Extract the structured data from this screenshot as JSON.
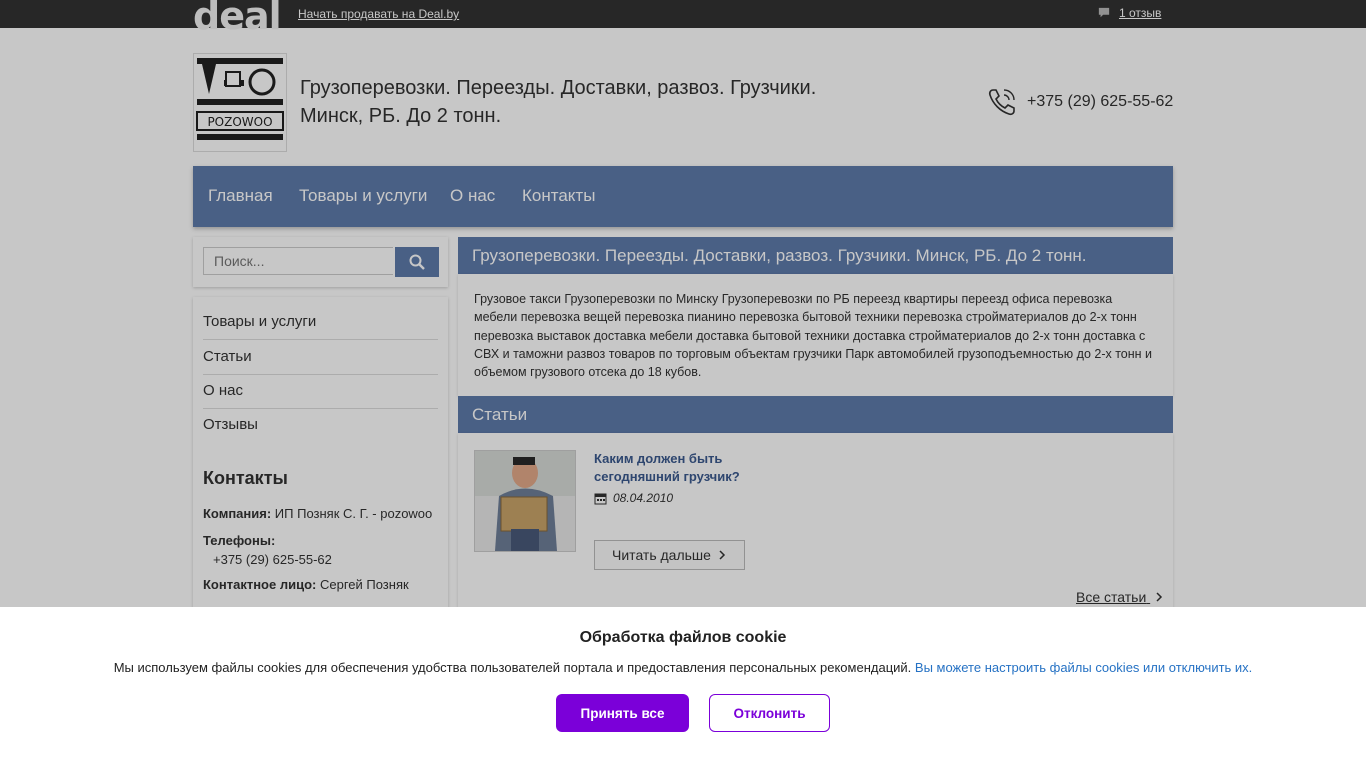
{
  "topbar": {
    "logo_text": "deal",
    "sell_link": "Начать продавать на Deal.by",
    "reviews_link": "1 отзыв"
  },
  "header": {
    "logo_text": "POZOWOO",
    "title": "Грузоперевозки. Переезды. Доставки, развоз. Грузчики. Минск, РБ. До 2 тонн.",
    "phone": "+375 (29) 625-55-62"
  },
  "nav": {
    "items": [
      "Главная",
      "Товары и услуги",
      "О нас",
      "Контакты"
    ]
  },
  "sidebar": {
    "search_placeholder": "Поиск...",
    "menu": [
      "Товары и услуги",
      "Статьи",
      "О нас",
      "Отзывы"
    ],
    "contacts_title": "Контакты",
    "company_label": "Компания:",
    "company_value": "ИП Позняк С. Г. - pozowoo",
    "phones_label": "Телефоны:",
    "phones_value": "+375 (29) 625-55-62",
    "person_label": "Контактное лицо:",
    "person_value": "Сергей Позняк"
  },
  "main": {
    "heading": "Грузоперевозки. Переезды. Доставки, развоз. Грузчики. Минск, РБ. До 2 тонн.",
    "description": "Грузовое такси Грузоперевозки по Минску Грузоперевозки по РБ переезд квартиры переезд офиса перевозка мебели перевозка вещей перевозка пианино перевозка бытовой техники перевозка стройматериалов до 2-х тонн перевозка выставок доставка мебели доставка бытовой техники доставка стройматериалов до 2-х тонн доставка с СВХ и таможни развоз товаров по торговым объектам грузчики Парк автомобилей грузоподъемностью до 2-х тонн и объемом грузового отсека до 18 кубов.",
    "articles_heading": "Статьи",
    "article_title": "Каким должен быть сегодняшний грузчик?",
    "article_date": "08.04.2010",
    "read_more": "Читать дальше",
    "all_articles": "Все статьи"
  },
  "cookie": {
    "title": "Обработка файлов cookie",
    "text": "Мы используем файлы cookies для обеспечения удобства пользователей портала и предоставления персональных рекомендаций.",
    "link": "Вы можете настроить файлы cookies или отключить их.",
    "accept": "Принять все",
    "decline": "Отклонить"
  },
  "colors": {
    "nav_blue": "#5e7bab",
    "accent_purple": "#7b00d9",
    "link_blue": "#2672c4"
  }
}
